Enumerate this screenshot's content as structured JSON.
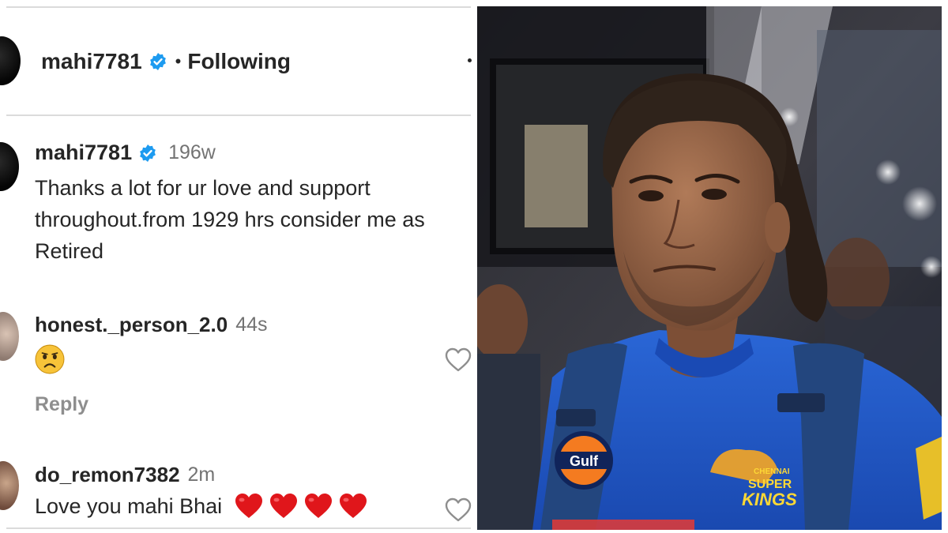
{
  "post_header": {
    "username": "mahi7781",
    "separator": "•",
    "follow_status": "Following"
  },
  "caption": {
    "username": "mahi7781",
    "age": "196w",
    "text": "Thanks a lot for ur love and support throughout.from 1929 hrs consider me as Retired"
  },
  "comments": [
    {
      "username": "honest._person_2.0",
      "time": "44s",
      "emoji_icon": "sad-face-emoji",
      "reply_label": "Reply"
    },
    {
      "username": "do_remon7382",
      "time": "2m",
      "text": "Love you mahi Bhai",
      "emoji_icon": "red-heart-emoji"
    }
  ],
  "photo": {
    "jersey_logos": {
      "sponsor": "Gulf",
      "team_top": "CHENNAI",
      "team_mid": "SUPER",
      "team_bottom": "KINGS"
    }
  },
  "colors": {
    "verified_badge": "#1d9bf0",
    "secondary_text": "#737373",
    "divider": "#dbdbdb",
    "jersey_blue": "#1f57c8",
    "heart_red": "#e0161b"
  }
}
